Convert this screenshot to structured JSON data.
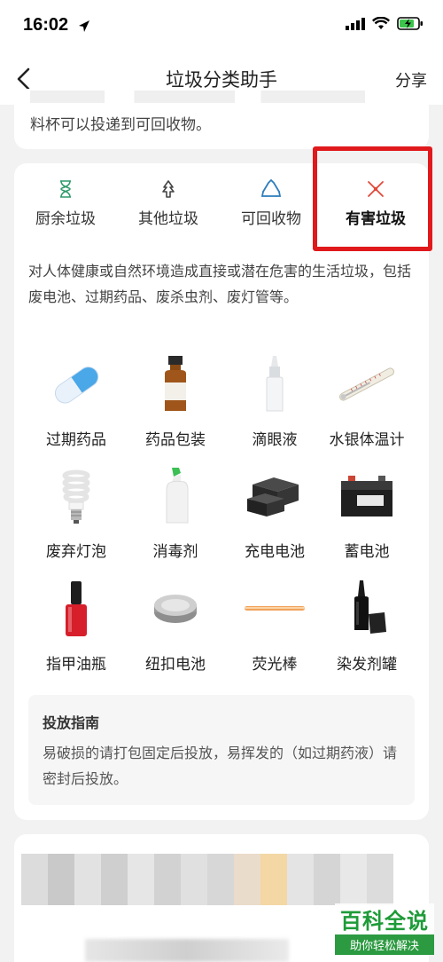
{
  "status_bar": {
    "time": "16:02"
  },
  "nav": {
    "title": "垃圾分类助手",
    "share_label": "分享"
  },
  "prev_card": {
    "text_tail": "料杯可以投递到可回收物。"
  },
  "tabs": [
    {
      "label": "厨余垃圾",
      "icon": "hourglass-icon",
      "color": "#2f9a6a"
    },
    {
      "label": "其他垃圾",
      "icon": "recycle-outline-icon",
      "color": "#444444"
    },
    {
      "label": "可回收物",
      "icon": "recycle-triangle-icon",
      "color": "#2e7dbb"
    },
    {
      "label": "有害垃圾",
      "icon": "hazard-cross-icon",
      "color": "#e04a3a"
    }
  ],
  "description": "对人体健康或自然环境造成直接或潜在危害的生活垃圾，包括废电池、过期药品、废杀虫剂、废灯管等。",
  "items": [
    {
      "label": "过期药品"
    },
    {
      "label": "药品包装"
    },
    {
      "label": "滴眼液"
    },
    {
      "label": "水银体温计"
    },
    {
      "label": "废弃灯泡"
    },
    {
      "label": "消毒剂"
    },
    {
      "label": "充电电池"
    },
    {
      "label": "蓄电池"
    },
    {
      "label": "指甲油瓶"
    },
    {
      "label": "纽扣电池"
    },
    {
      "label": "荧光棒"
    },
    {
      "label": "染发剂罐"
    }
  ],
  "guide": {
    "title": "投放指南",
    "text": "易破损的请打包固定后投放，易挥发的（如过期药液）请密封后投放。"
  },
  "watermark": {
    "main": "百科全说",
    "sub": "助你轻松解决"
  },
  "colors": {
    "highlight": "#e0191c",
    "watermark_green": "#2c9a41"
  }
}
